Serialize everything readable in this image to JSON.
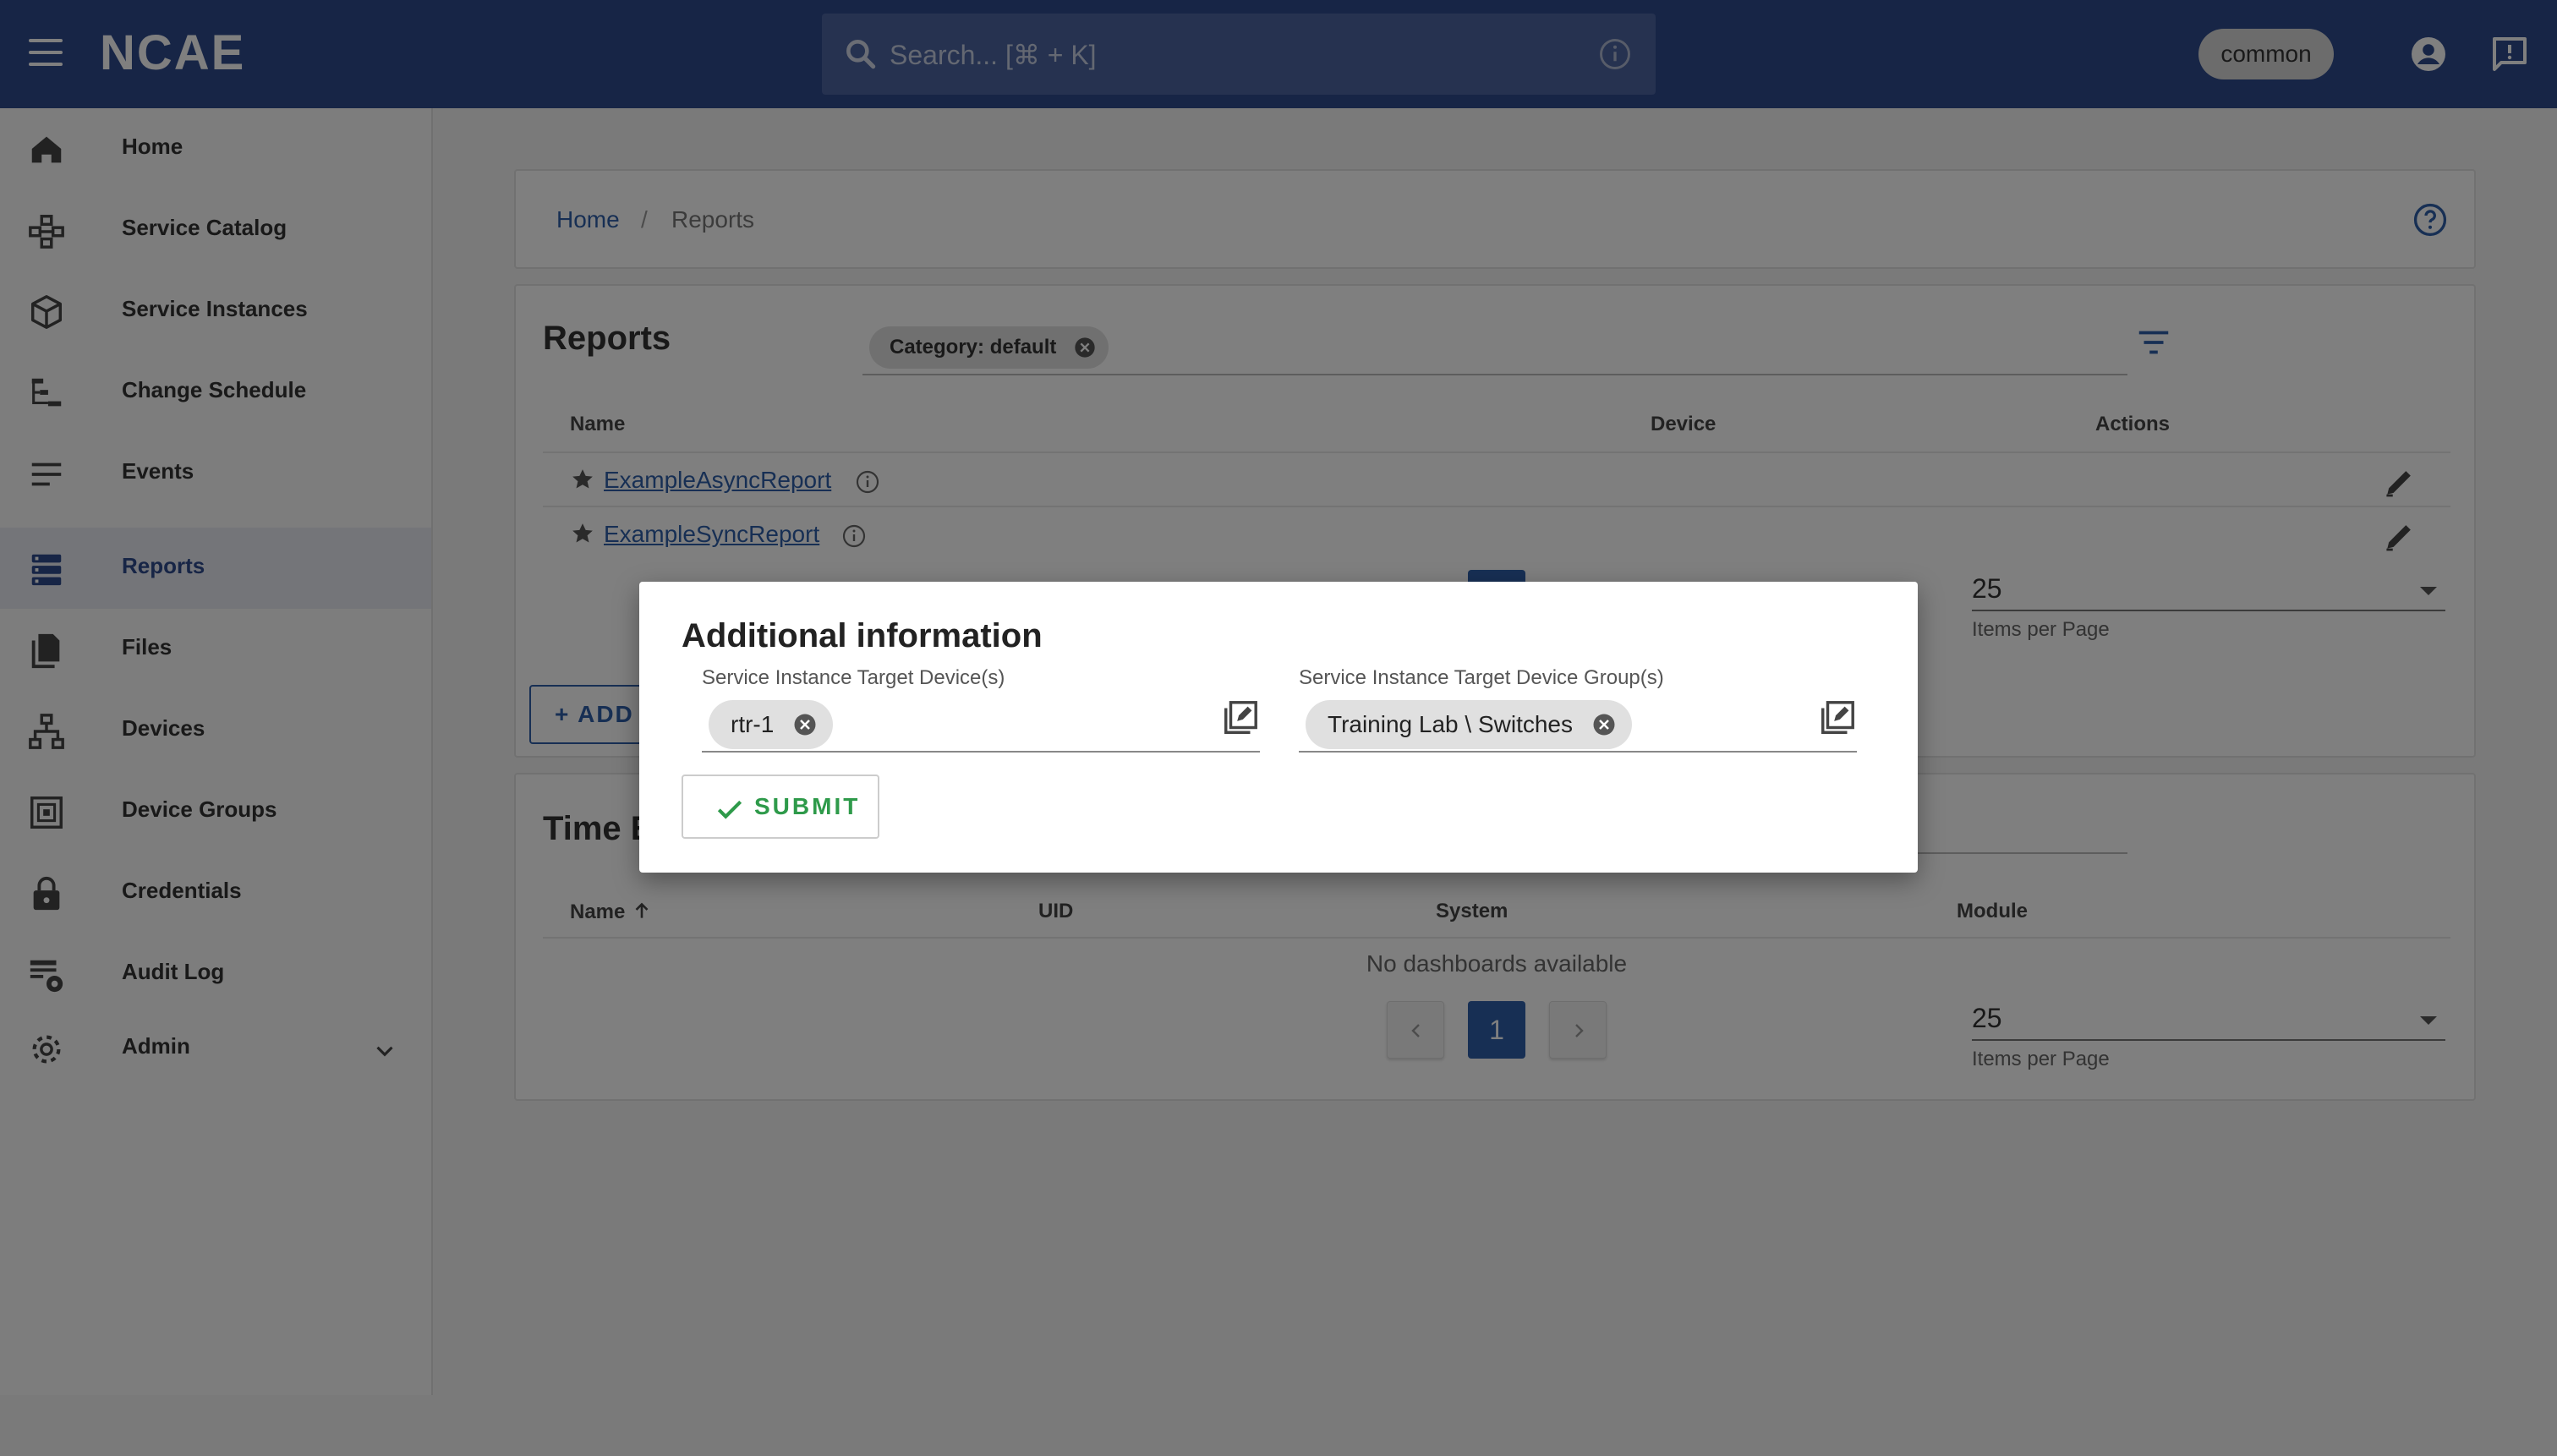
{
  "header": {
    "logo": "NCAE",
    "search_placeholder": "Search... [⌘ + K]",
    "user": "common"
  },
  "sidebar": {
    "items": [
      {
        "label": "Home",
        "icon": "home-icon"
      },
      {
        "label": "Service Catalog",
        "icon": "catalog-icon"
      },
      {
        "label": "Service Instances",
        "icon": "cube-icon"
      },
      {
        "label": "Change Schedule",
        "icon": "schedule-icon"
      },
      {
        "label": "Events",
        "icon": "events-icon"
      },
      {
        "label": "Reports",
        "icon": "reports-icon",
        "active": true
      },
      {
        "label": "Files",
        "icon": "files-icon"
      },
      {
        "label": "Devices",
        "icon": "devices-icon"
      },
      {
        "label": "Device Groups",
        "icon": "device-groups-icon"
      },
      {
        "label": "Credentials",
        "icon": "lock-icon"
      },
      {
        "label": "Audit Log",
        "icon": "audit-log-icon"
      },
      {
        "label": "Admin",
        "icon": "gear-icon"
      }
    ]
  },
  "breadcrumb": {
    "home": "Home",
    "separator": "/",
    "current": "Reports"
  },
  "reports": {
    "title": "Reports",
    "filter_chip": "Category: default",
    "columns": [
      "Name",
      "Device",
      "Actions"
    ],
    "rows": [
      {
        "name": "ExampleAsyncReport"
      },
      {
        "name": "ExampleSyncReport"
      }
    ],
    "items_per_page": "25",
    "items_per_page_label": "Items per Page",
    "add_label": "ADD"
  },
  "time": {
    "title": "Time E",
    "columns": [
      "Name",
      "UID",
      "System",
      "Module"
    ],
    "empty": "No dashboards available",
    "page": "1",
    "items_per_page": "25",
    "items_per_page_label": "Items per Page"
  },
  "modal": {
    "title": "Additional information",
    "field1": {
      "label": "Service Instance Target Device(s)",
      "chip": "rtr-1"
    },
    "field2": {
      "label": "Service Instance Target Device Group(s)",
      "chip": "Training Lab \\ Switches"
    },
    "submit": "SUBMIT"
  },
  "colors": {
    "header": "#2e4a8d",
    "accent": "#2e5fa8",
    "submit": "#2e9a4a"
  }
}
